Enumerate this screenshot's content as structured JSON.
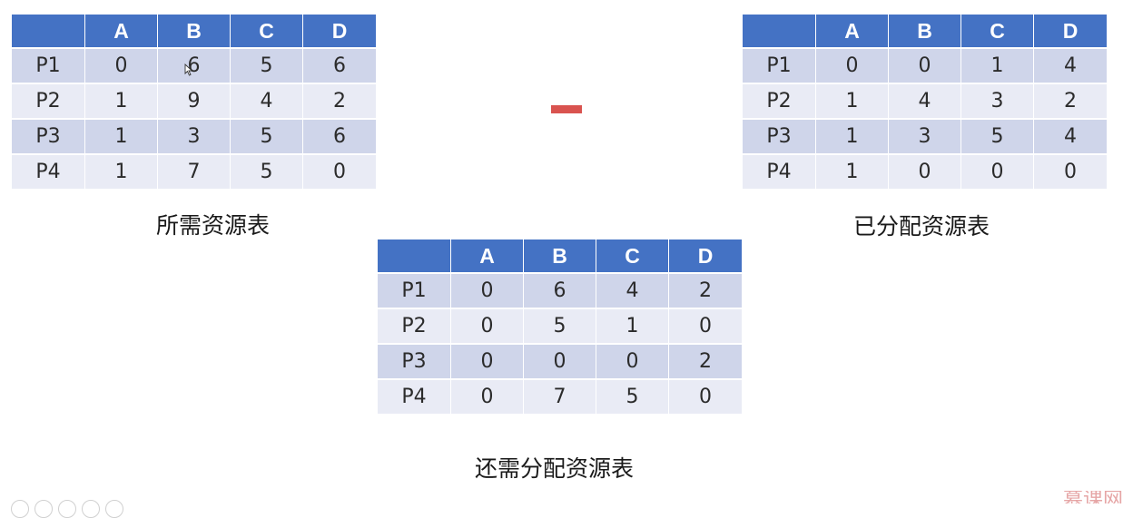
{
  "columns": [
    "",
    "A",
    "B",
    "C",
    "D"
  ],
  "need_table": {
    "caption": "所需资源表",
    "rows": [
      {
        "label": "P1",
        "values": [
          "0",
          "6",
          "5",
          "6"
        ]
      },
      {
        "label": "P2",
        "values": [
          "1",
          "9",
          "4",
          "2"
        ]
      },
      {
        "label": "P3",
        "values": [
          "1",
          "3",
          "5",
          "6"
        ]
      },
      {
        "label": "P4",
        "values": [
          "1",
          "7",
          "5",
          "0"
        ]
      }
    ]
  },
  "allocated_table": {
    "caption": "已分配资源表",
    "rows": [
      {
        "label": "P1",
        "values": [
          "0",
          "0",
          "1",
          "4"
        ]
      },
      {
        "label": "P2",
        "values": [
          "1",
          "4",
          "3",
          "2"
        ]
      },
      {
        "label": "P3",
        "values": [
          "1",
          "3",
          "5",
          "4"
        ]
      },
      {
        "label": "P4",
        "values": [
          "1",
          "0",
          "0",
          "0"
        ]
      }
    ]
  },
  "remaining_table": {
    "caption": "还需分配资源表",
    "rows": [
      {
        "label": "P1",
        "values": [
          "0",
          "6",
          "4",
          "2"
        ]
      },
      {
        "label": "P2",
        "values": [
          "0",
          "5",
          "1",
          "0"
        ]
      },
      {
        "label": "P3",
        "values": [
          "0",
          "0",
          "0",
          "2"
        ]
      },
      {
        "label": "P4",
        "values": [
          "0",
          "7",
          "5",
          "0"
        ]
      }
    ]
  },
  "operator": "minus",
  "watermark": "慕课网",
  "colors": {
    "header_bg": "#4472c4",
    "row_odd": "#cfd5ea",
    "row_even": "#e9ebf5",
    "minus": "#d9534f"
  }
}
